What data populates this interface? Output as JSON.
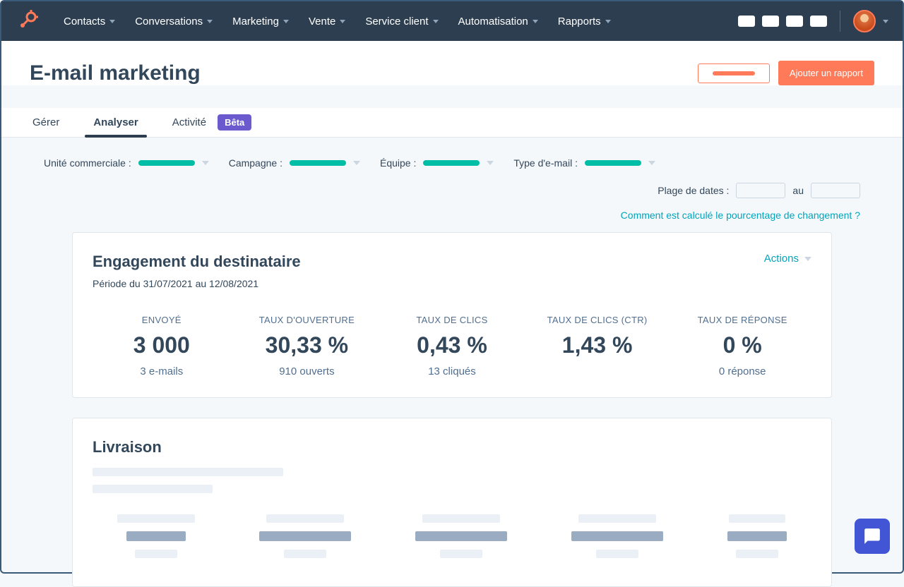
{
  "nav": {
    "items": [
      "Contacts",
      "Conversations",
      "Marketing",
      "Vente",
      "Service client",
      "Automatisation",
      "Rapports"
    ]
  },
  "page": {
    "title": "E-mail marketing",
    "add_report": "Ajouter un rapport"
  },
  "tabs": {
    "manage": "Gérer",
    "analyze": "Analyser",
    "activity": "Activité",
    "beta": "Bêta"
  },
  "filters": {
    "business_unit": "Unité commerciale :",
    "campaign": "Campagne :",
    "team": "Équipe :",
    "email_type": "Type d'e-mail :",
    "date_range": "Plage de dates :",
    "to": "au"
  },
  "help_link": "Comment est calculé le pourcentage de changement ?",
  "engagement": {
    "title": "Engagement du destinataire",
    "period": "Période du 31/07/2021 au 12/08/2021",
    "actions": "Actions",
    "stats": [
      {
        "label": "ENVOYÉ",
        "value": "3 000",
        "detail": "3 e-mails"
      },
      {
        "label": "TAUX D'OUVERTURE",
        "value": "30,33 %",
        "detail": "910 ouverts"
      },
      {
        "label": "TAUX DE CLICS",
        "value": "0,43 %",
        "detail": "13 cliqués"
      },
      {
        "label": "TAUX DE CLICS (CTR)",
        "value": "1,43 %",
        "detail": ""
      },
      {
        "label": "TAUX DE RÉPONSE",
        "value": "0 %",
        "detail": "0 réponse"
      }
    ]
  },
  "delivery": {
    "title": "Livraison"
  }
}
